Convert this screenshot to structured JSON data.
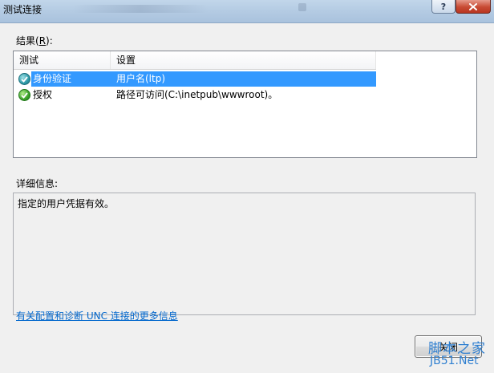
{
  "window": {
    "title": "测试连接",
    "help_label": "?",
    "close_label": "✕"
  },
  "results": {
    "label_prefix": "结果(",
    "label_accel": "R",
    "label_suffix": "):",
    "columns": [
      "测试",
      "设置"
    ],
    "rows": [
      {
        "test": "身份验证",
        "setting": "用户名(ltp)",
        "status_icon": "info-check-icon",
        "selected": true
      },
      {
        "test": "授权",
        "setting": "路径可访问(C:\\inetpub\\wwwroot)。",
        "status_icon": "success-check-icon",
        "selected": false
      }
    ]
  },
  "details": {
    "label": "详细信息:",
    "text": "指定的用户凭据有效。"
  },
  "link_text": "有关配置和诊断 UNC 连接的更多信息",
  "close_button_label": "关闭",
  "watermark": {
    "line1": "脚本之家",
    "line2": "JB51.Net"
  },
  "colors": {
    "selection": "#3399ff",
    "link": "#0066cc",
    "titlebar": "#b4cbe3",
    "close_red": "#c84a33"
  }
}
